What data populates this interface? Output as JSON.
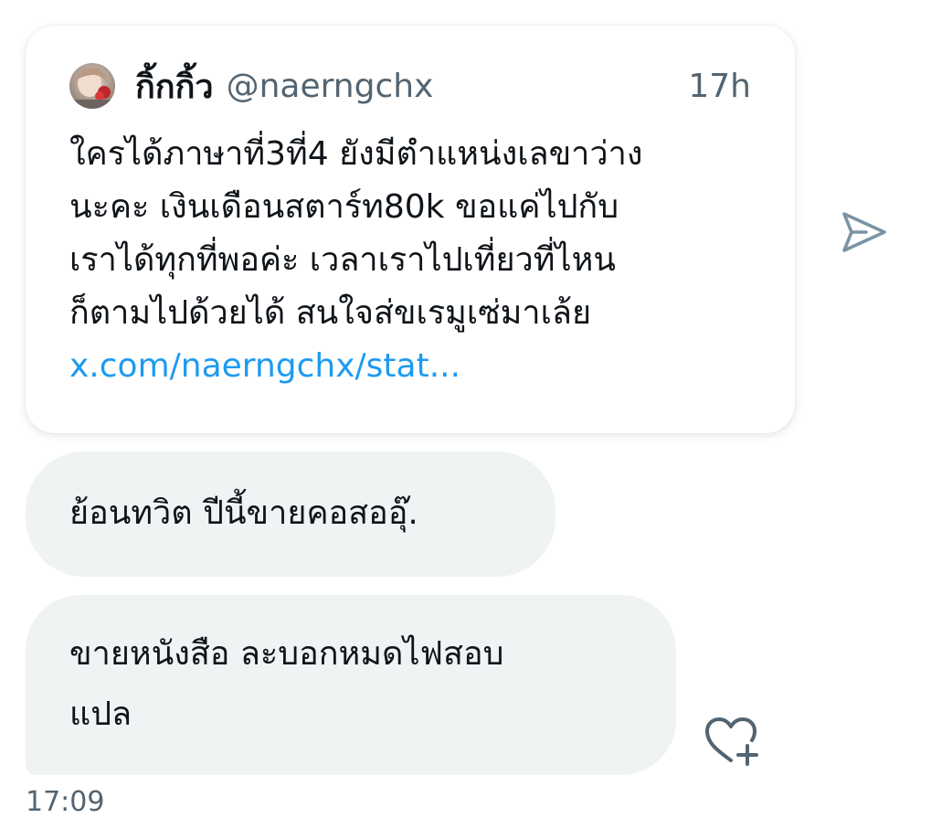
{
  "quote": {
    "display_name": "กิ้กกิ้ว",
    "handle": "@naerngchx",
    "age": "17h",
    "lines": [
      "ใครได้ภาษาที่3ที่4 ยังมีตำแหน่งเลขาว่าง",
      "นะคะ เงินเดือนสตาร์ท80k ขอแค่ไปกับ",
      "เราได้ทุกที่พอค่ะ เวลาเราไปเที่ยวที่ไหน",
      "ก็ตามไปด้วยได้ สนใจส่ขเรมูเซ่มาเล้ย"
    ],
    "link": "x.com/naerngchx/stat..."
  },
  "messages": [
    {
      "lines": [
        "ย้อนทวิต ปีนี้ขายคอสออุ๊."
      ]
    },
    {
      "lines": [
        "ขายหนังสือ ละบอกหมดไฟสอบ",
        "แปล"
      ]
    }
  ],
  "timestamp": "17:09",
  "icons": {
    "share": "share-icon",
    "react": "add-reaction-icon"
  },
  "colors": {
    "link": "#1d9bf0",
    "secondary_text": "#536471",
    "bubble": "#eff3f4"
  }
}
